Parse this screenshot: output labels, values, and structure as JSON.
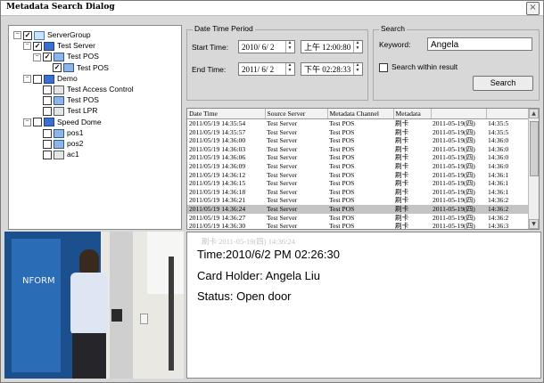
{
  "window": {
    "title": "Metadata Search Dialog",
    "close_glyph": "×"
  },
  "tree": {
    "nodes": [
      {
        "label": "ServerGroup",
        "level": 0,
        "checked": true,
        "expander": "−",
        "icon": "folder-icon"
      },
      {
        "label": "Test Server",
        "level": 1,
        "checked": true,
        "expander": "−",
        "icon": "server-icon"
      },
      {
        "label": "Test POS",
        "level": 2,
        "checked": true,
        "expander": "−",
        "icon": "pos-icon"
      },
      {
        "label": "Test POS",
        "level": 3,
        "checked": true,
        "expander": "",
        "icon": "pos-device-icon"
      },
      {
        "label": "Demo",
        "level": 1,
        "checked": false,
        "expander": "−",
        "icon": "server-icon"
      },
      {
        "label": "Test Access Control",
        "level": 2,
        "checked": false,
        "expander": "",
        "icon": "access-control-icon"
      },
      {
        "label": "Test POS",
        "level": 2,
        "checked": false,
        "expander": "",
        "icon": "pos-icon"
      },
      {
        "label": "Test LPR",
        "level": 2,
        "checked": false,
        "expander": "",
        "icon": "lpr-icon"
      },
      {
        "label": "Speed Dome",
        "level": 1,
        "checked": false,
        "expander": "−",
        "icon": "server-icon"
      },
      {
        "label": "pos1",
        "level": 2,
        "checked": false,
        "expander": "",
        "icon": "pos-icon"
      },
      {
        "label": "pos2",
        "level": 2,
        "checked": false,
        "expander": "",
        "icon": "pos-icon"
      },
      {
        "label": "ac1",
        "level": 2,
        "checked": false,
        "expander": "",
        "icon": "access-control-icon"
      }
    ]
  },
  "datetime": {
    "group_label": "Date Time Period",
    "start_label": "Start Time:",
    "start_date": "2010/ 6/ 2",
    "start_time": "上午 12:00:80",
    "end_label": "End Time:",
    "end_date": "2011/ 6/ 2",
    "end_time": "下午 02:28:33"
  },
  "search": {
    "group_label": "Search",
    "keyword_label": "Keyword:",
    "keyword_value": "Angela",
    "within_label": "Search within result",
    "within_checked": false,
    "button_label": "Search"
  },
  "results": {
    "columns": [
      "Date Time",
      "Source Server",
      "Metadata Channel",
      "Metadata",
      "",
      ""
    ],
    "selected_index": 10,
    "rows": [
      [
        "2011/05/19 14:35:54",
        "Test Server",
        "Test POS",
        "刷卡",
        "2011-05-19(四)",
        "14:35:5"
      ],
      [
        "2011/05/19 14:35:57",
        "Test Server",
        "Test POS",
        "刷卡",
        "2011-05-19(四)",
        "14:35:5"
      ],
      [
        "2011/05/19 14:36:00",
        "Test Server",
        "Test POS",
        "刷卡",
        "2011-05-19(四)",
        "14:36:0"
      ],
      [
        "2011/05/19 14:36:03",
        "Test Server",
        "Test POS",
        "刷卡",
        "2011-05-19(四)",
        "14:36:0"
      ],
      [
        "2011/05/19 14:36:06",
        "Test Server",
        "Test POS",
        "刷卡",
        "2011-05-19(四)",
        "14:36:0"
      ],
      [
        "2011/05/19 14:36:09",
        "Test Server",
        "Test POS",
        "刷卡",
        "2011-05-19(四)",
        "14:36:0"
      ],
      [
        "2011/05/19 14:36:12",
        "Test Server",
        "Test POS",
        "刷卡",
        "2011-05-19(四)",
        "14:36:1"
      ],
      [
        "2011/05/19 14:36:15",
        "Test Server",
        "Test POS",
        "刷卡",
        "2011-05-19(四)",
        "14:36:1"
      ],
      [
        "2011/05/19 14:36:18",
        "Test Server",
        "Test POS",
        "刷卡",
        "2011-05-19(四)",
        "14:36:1"
      ],
      [
        "2011/05/19 14:36:21",
        "Test Server",
        "Test POS",
        "刷卡",
        "2011-05-19(四)",
        "14:36:2"
      ],
      [
        "2011/05/19 14:36:24",
        "Test Server",
        "Test POS",
        "刷卡",
        "2011-05-19(四)",
        "14:36:2"
      ],
      [
        "2011/05/19 14:36:27",
        "Test Server",
        "Test POS",
        "刷卡",
        "2011-05-19(四)",
        "14:36:2"
      ],
      [
        "2011/05/19 14:36:30",
        "Test Server",
        "Test POS",
        "刷卡",
        "2011-05-19(四)",
        "14:36:3"
      ]
    ]
  },
  "detail": {
    "ghost_text": "刷卡          2011-05-19(四)  14:36:24",
    "time_line": "Time:2010/6/2  PM 02:26:30",
    "holder_line": "Card Holder: Angela Liu",
    "status_line": "Status: Open door"
  },
  "video": {
    "poster_text": "NFORM"
  }
}
